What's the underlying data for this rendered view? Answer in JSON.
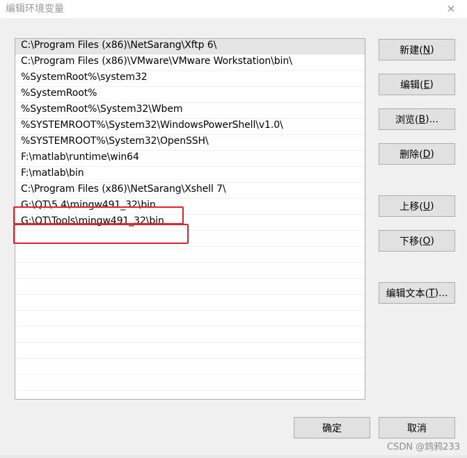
{
  "window": {
    "title": "编辑环境变量",
    "close_glyph": "✕"
  },
  "list": {
    "items": [
      "C:\\Program Files (x86)\\NetSarang\\Xftp 6\\",
      "C:\\Program Files (x86)\\VMware\\VMware Workstation\\bin\\",
      "%SystemRoot%\\system32",
      "%SystemRoot%",
      "%SystemRoot%\\System32\\Wbem",
      "%SYSTEMROOT%\\System32\\WindowsPowerShell\\v1.0\\",
      "%SYSTEMROOT%\\System32\\OpenSSH\\",
      "F:\\matlab\\runtime\\win64",
      "F:\\matlab\\bin",
      "C:\\Program Files (x86)\\NetSarang\\Xshell 7\\",
      "G:\\QT\\5.4\\mingw491_32\\bin",
      "G:\\QT\\Tools\\mingw491_32\\bin"
    ],
    "selected_index": 0
  },
  "buttons": {
    "new": {
      "text": "新建(",
      "key": "N",
      "end": ")"
    },
    "edit": {
      "text": "编辑(",
      "key": "E",
      "end": ")"
    },
    "browse": {
      "text": "浏览(",
      "key": "B",
      "end": ")..."
    },
    "delete": {
      "text": "删除(",
      "key": "D",
      "end": ")"
    },
    "move_up": {
      "text": "上移(",
      "key": "U",
      "end": ")"
    },
    "move_down": {
      "text": "下移(",
      "key": "O",
      "end": ")"
    },
    "edit_text": {
      "text": "编辑文本(",
      "key": "T",
      "end": ")..."
    },
    "ok": "确定",
    "cancel": "取消"
  },
  "watermark": "CSDN @鸩鸦233",
  "colors": {
    "highlight": "#e0222a",
    "selected_row": "#e5e5e5"
  }
}
